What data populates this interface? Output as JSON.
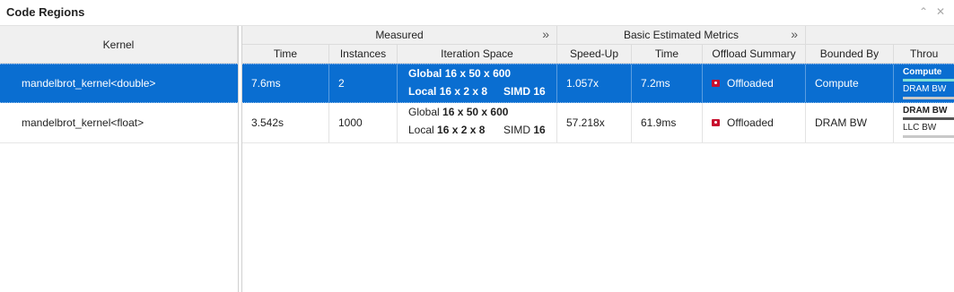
{
  "window": {
    "title": "Code Regions"
  },
  "left": {
    "kernel_header": "Kernel"
  },
  "groups": [
    {
      "label": "Measured",
      "expand": "»"
    },
    {
      "label": "Basic Estimated Metrics",
      "expand": "»"
    }
  ],
  "columns": [
    "Time",
    "Instances",
    "Iteration Space",
    "Speed-Up",
    "Time",
    "Offload Summary",
    "Bounded By",
    "Throu"
  ],
  "rows": [
    {
      "kernel": "mandelbrot_kernel<double>",
      "time": "7.6ms",
      "instances": "2",
      "iter_global_label": "Global",
      "iter_global_value": "16 x 50 x 600",
      "iter_local_label": "Local",
      "iter_local_value": "16 x 2 x 8",
      "iter_simd_label": "SIMD",
      "iter_simd_value": "16",
      "speedup": "1.057x",
      "est_time": "7.2ms",
      "offload": "Offloaded",
      "bounded_by": "Compute",
      "throughput_1": "Compute",
      "throughput_2": "DRAM BW"
    },
    {
      "kernel": "mandelbrot_kernel<float>",
      "time": "3.542s",
      "instances": "1000",
      "iter_global_label": "Global",
      "iter_global_value": "16 x 50 x 600",
      "iter_local_label": "Local",
      "iter_local_value": "16 x 2 x 8",
      "iter_simd_label": "SIMD",
      "iter_simd_value": "16",
      "speedup": "57.218x",
      "est_time": "61.9ms",
      "offload": "Offloaded",
      "bounded_by": "DRAM BW",
      "throughput_1": "DRAM BW",
      "throughput_2": "LLC BW"
    }
  ],
  "colors": {
    "selection": "#0a6ed1",
    "header_bg": "#f0f0f0",
    "offload_icon": "#c8102e"
  }
}
